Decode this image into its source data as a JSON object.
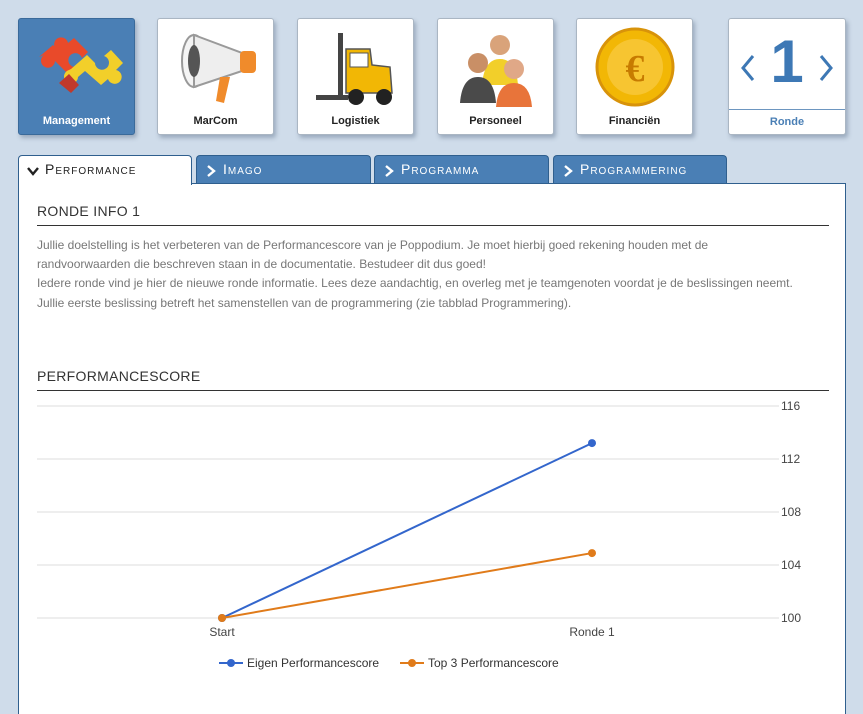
{
  "nav": {
    "tiles": [
      {
        "label": "Management"
      },
      {
        "label": "MarCom"
      },
      {
        "label": "Logistiek"
      },
      {
        "label": "Personeel"
      },
      {
        "label": "Financiën"
      }
    ],
    "round": {
      "number": "1",
      "label": "Ronde"
    }
  },
  "tabs": [
    {
      "label": "Performance"
    },
    {
      "label": "Imago"
    },
    {
      "label": "Programma"
    },
    {
      "label": "Programmering"
    }
  ],
  "info": {
    "title": "RONDE INFO 1",
    "lines": [
      "Jullie doelstelling is het verbeteren van de Performancescore van je Poppodium. Je moet hierbij goed rekening houden met de",
      "randvoorwaarden die beschreven staan in de documentatie. Bestudeer dit dus goed!",
      "Iedere ronde vind je hier de nieuwe ronde informatie. Lees deze aandachtig, en overleg met je teamgenoten voordat je de beslissingen neemt.",
      "Jullie eerste beslissing betreft het samenstellen van de programmering (zie tabblad Programmering)."
    ]
  },
  "chart_section": {
    "title": "PERFORMANCESCORE"
  },
  "chart_data": {
    "type": "line",
    "title": "",
    "xlabel": "",
    "ylabel": "",
    "categories": [
      "Start",
      "Ronde 1"
    ],
    "ylim": [
      100,
      116
    ],
    "yticks": [
      "100",
      "104",
      "108",
      "112",
      "116"
    ],
    "grid": true,
    "legend": "bottom",
    "series": [
      {
        "name": "Eigen Performancescore",
        "values": [
          100,
          113.2
        ],
        "color": "#3366cc"
      },
      {
        "name": "Top 3 Performancescore",
        "values": [
          100,
          104.9
        ],
        "color": "#e07b1a"
      }
    ]
  }
}
